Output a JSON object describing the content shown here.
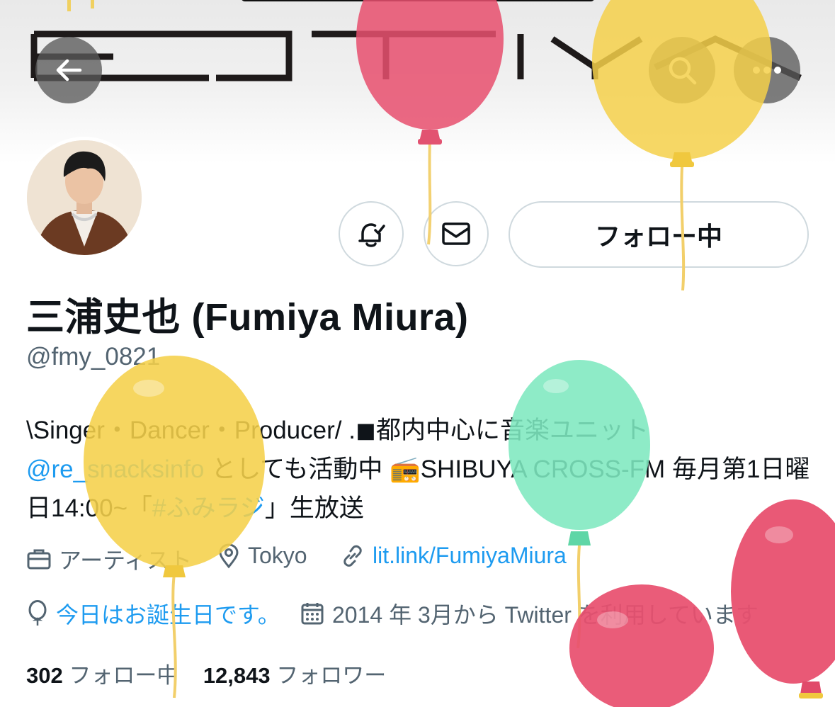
{
  "header": {
    "back_icon": "arrow-left-icon",
    "search_icon": "search-icon",
    "more_icon": "more-icon"
  },
  "profile": {
    "name": "三浦史也 (Fumiya Miura)",
    "handle": "@fmy_0821",
    "follow_label": "フォロー中",
    "bio": {
      "part1": "\\Singer・Dancer・Producer/ .◼︎都内中心に音楽ユニット",
      "mention": "@re_snacksinfo",
      "part2": " としても活動中 📻SHIBUYA CROSS-FM 毎月第1日曜日14:00~「",
      "hashtag": "#ふみラジ",
      "part3": "」生放送"
    },
    "category": "アーティスト",
    "location": "Tokyo",
    "website": "lit.link/FumiyaMiura",
    "birthday": "今日はお誕生日です。",
    "joined": "2014 年 3月から Twitter を利用しています"
  },
  "stats": {
    "following_count": "302",
    "following_label": "フォロー中",
    "followers_count": "12,843",
    "followers_label": "フォロワー"
  },
  "colors": {
    "accent": "#1d9bf0",
    "secondary_text": "#536471",
    "balloon_pink": "#e8506f",
    "balloon_yellow": "#f5d04a",
    "balloon_green": "#7ee8bf"
  }
}
